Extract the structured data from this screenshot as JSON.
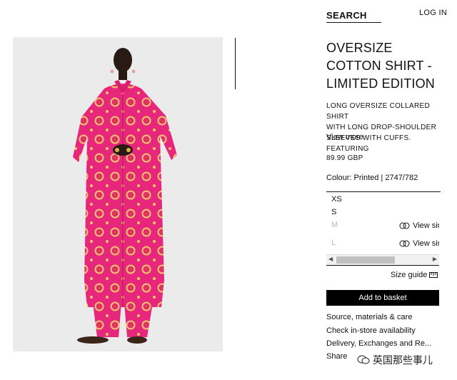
{
  "header": {
    "search_label": "SEARCH",
    "login_label": "LOG IN"
  },
  "product": {
    "title": "OVERSIZE COTTON SHIRT - LIMITED EDITION",
    "description": "LONG OVERSIZE COLLARED SHIRT\nWITH LONG DROP-SHOULDER\nSLEEVES WITH CUFFS. FEATURING",
    "view_more": "View more",
    "price": "89.99 GBP",
    "colour": "Colour: Printed | 2747/782"
  },
  "sizes": [
    {
      "label": "XS",
      "available": true,
      "similar": ""
    },
    {
      "label": "S",
      "available": true,
      "similar": ""
    },
    {
      "label": "M",
      "available": false,
      "similar": "View sir"
    },
    {
      "label": "L",
      "available": false,
      "similar": "View sir"
    }
  ],
  "size_guide": "Size guide",
  "add_to_basket": "Add to basket",
  "links": {
    "source": "Source, materials & care",
    "instore": "Check in-store availability",
    "delivery": "Delivery, Exchanges and Re...",
    "share": "Share"
  },
  "watermark": "英国那些事儿",
  "colors": {
    "dress": "#e8287c",
    "accent": "#000000"
  }
}
